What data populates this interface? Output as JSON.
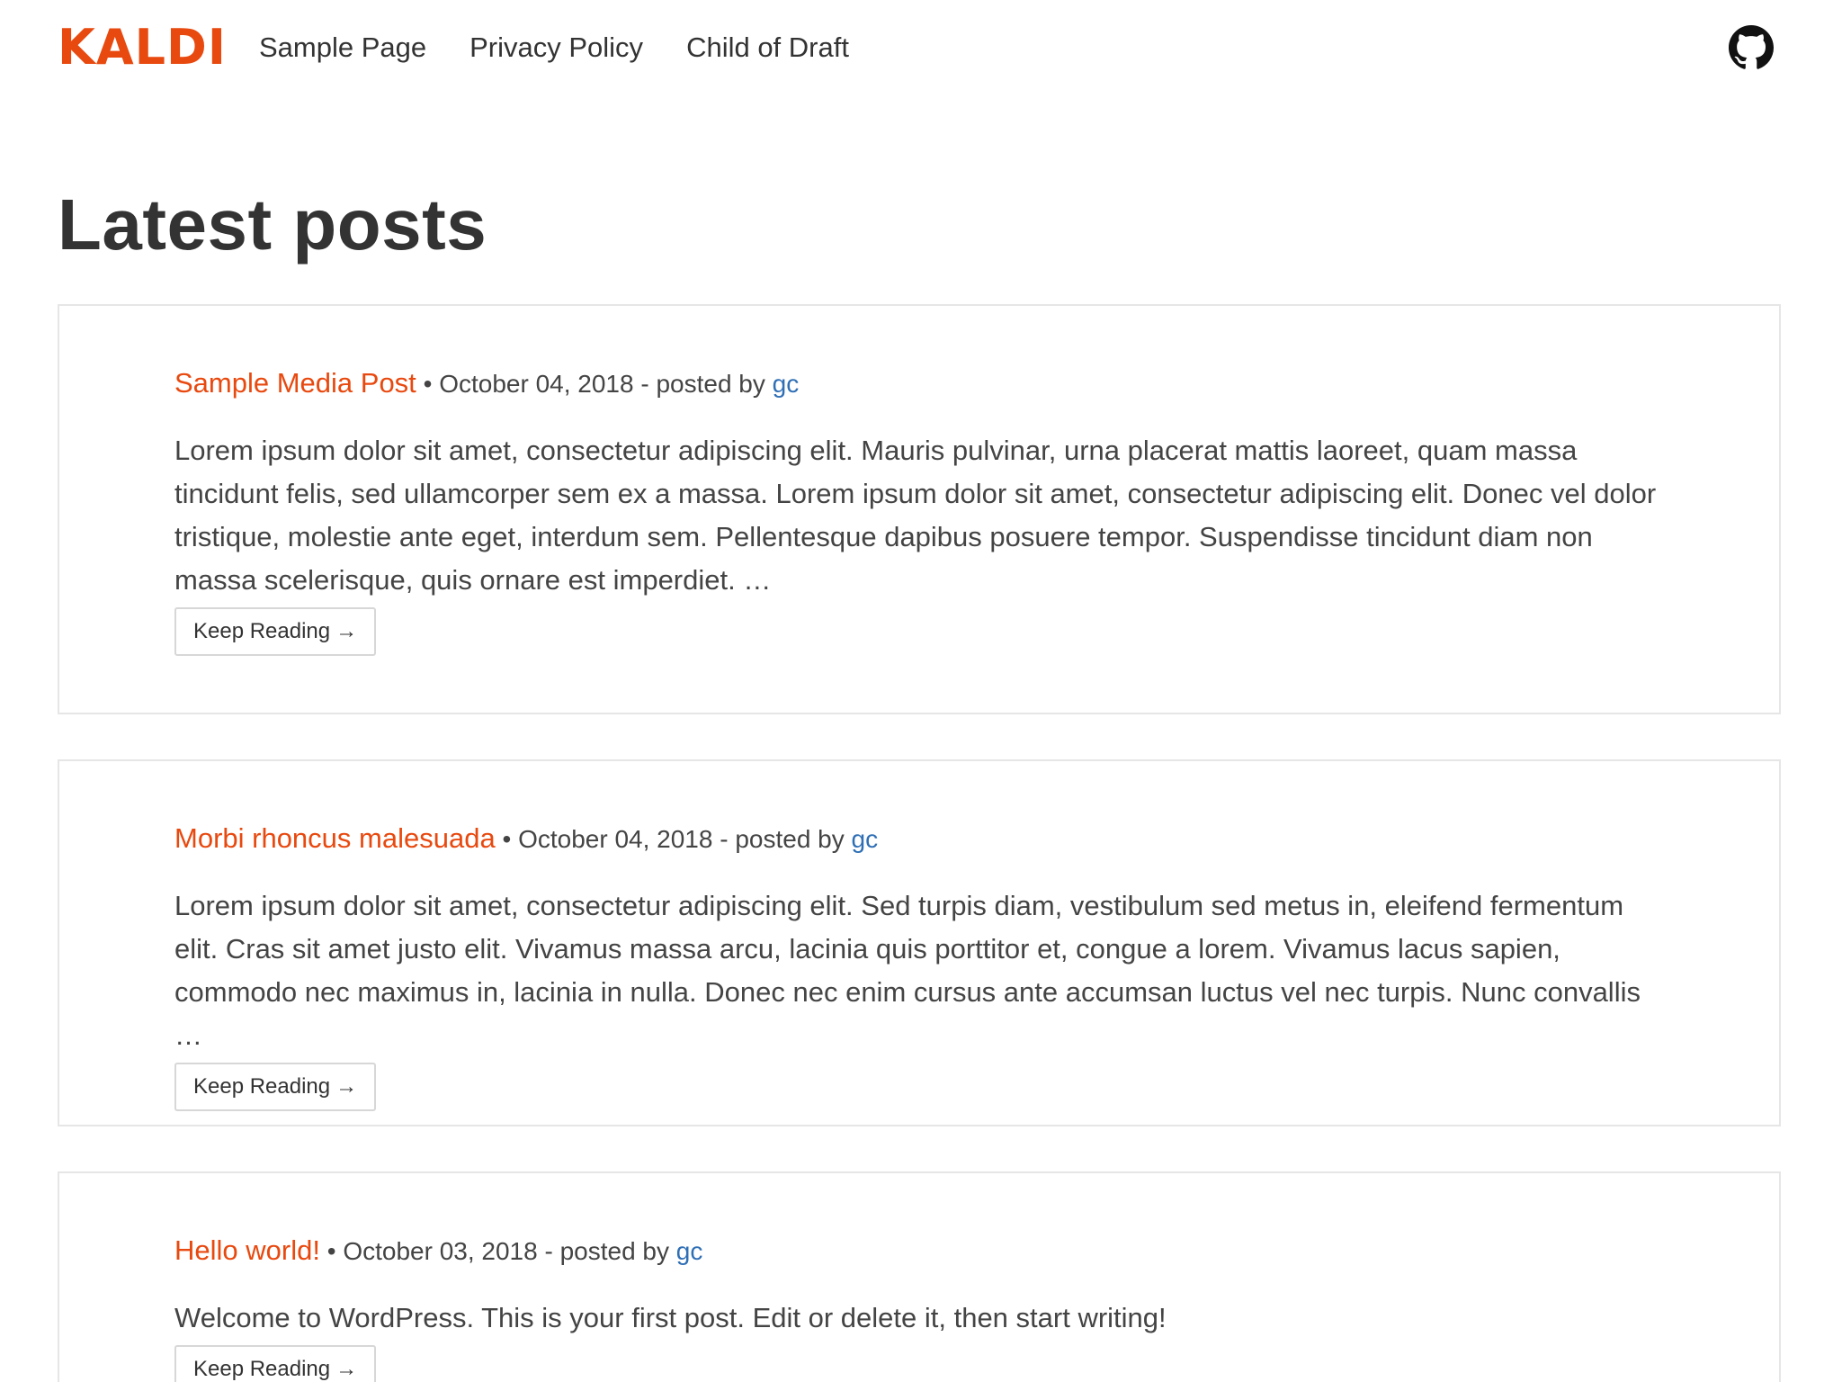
{
  "site": {
    "logo": "KALDI",
    "nav": [
      {
        "label": "Sample Page"
      },
      {
        "label": "Privacy Policy"
      },
      {
        "label": "Child of Draft"
      }
    ],
    "github_icon": "github-icon"
  },
  "main": {
    "heading": "Latest posts",
    "posts": [
      {
        "title": "Sample Media Post",
        "separator": "•",
        "date": "October 04, 2018",
        "posted_by": "- posted by",
        "author": "gc",
        "excerpt": "Lorem ipsum dolor sit amet, consectetur adipiscing elit. Mauris pulvinar, urna placerat mattis laoreet, quam massa tincidunt felis, sed ullamcorper sem ex a massa. Lorem ipsum dolor sit amet, consectetur adipiscing elit. Donec vel dolor tristique, molestie ante eget, interdum sem. Pellentesque dapibus posuere tempor. Suspendisse tincidunt diam non massa scelerisque, quis ornare est imperdiet. …",
        "button": "Keep Reading",
        "button_arrow": "→"
      },
      {
        "title": "Morbi rhoncus malesuada",
        "separator": "•",
        "date": "October 04, 2018",
        "posted_by": "- posted by",
        "author": "gc",
        "excerpt": "Lorem ipsum dolor sit amet, consectetur adipiscing elit. Sed turpis diam, vestibulum sed metus in, eleifend fermentum elit. Cras sit amet justo elit. Vivamus massa arcu, lacinia quis porttitor et, congue a lorem. Vivamus lacus sapien, commodo nec maximus in, lacinia in nulla. Donec nec enim cursus ante accumsan luctus vel nec turpis. Nunc convallis …",
        "button": "Keep Reading",
        "button_arrow": "→"
      },
      {
        "title": "Hello world!",
        "separator": "•",
        "date": "October 03, 2018",
        "posted_by": "- posted by",
        "author": "gc",
        "excerpt": "Welcome to WordPress. This is your first post. Edit or delete it, then start writing!",
        "button": "Keep Reading",
        "button_arrow": "→"
      }
    ]
  },
  "colors": {
    "accent": "#e8490f",
    "link": "#2f6fb5",
    "text": "#333333",
    "border": "#e6e6e6"
  }
}
